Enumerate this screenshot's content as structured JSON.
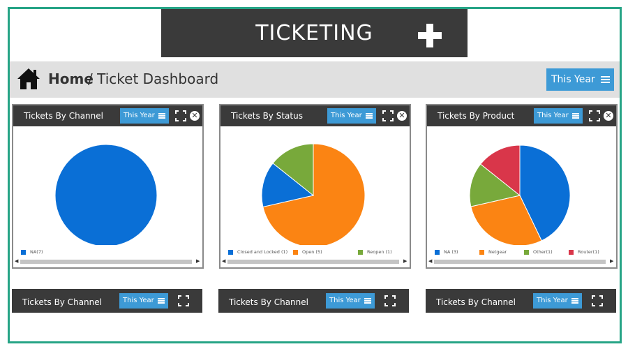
{
  "app": {
    "title": "TICKETING"
  },
  "breadcrumb": {
    "home": "Home",
    "separator": "/",
    "page": "Ticket Dashboard"
  },
  "filter": {
    "label": "This Year"
  },
  "colors": {
    "accent": "#3d9ad6",
    "frame": "#26a486",
    "header": "#3a3a3a",
    "blue": "#0a6fd6",
    "orange": "#fb8413",
    "green": "#78a93b",
    "red": "#d9364a"
  },
  "widgets": [
    {
      "title": "Tickets By Channel",
      "filter": "This Year",
      "legend": [
        {
          "label": "NA(7)",
          "color": "#0a6fd6"
        }
      ],
      "chart_data": {
        "type": "pie",
        "slices": [
          {
            "label": "NA",
            "value": 7,
            "color": "#0a6fd6"
          }
        ]
      }
    },
    {
      "title": "Tickets By Status",
      "filter": "This Year",
      "legend": [
        {
          "label": "Closed and Locked (1)",
          "color": "#0a6fd6"
        },
        {
          "label": "Open (5)",
          "color": "#fb8413"
        },
        {
          "label": "Reopen (1)",
          "color": "#78a93b"
        }
      ],
      "chart_data": {
        "type": "pie",
        "slices": [
          {
            "label": "Open",
            "value": 5,
            "color": "#fb8413"
          },
          {
            "label": "Closed and Locked",
            "value": 1,
            "color": "#0a6fd6"
          },
          {
            "label": "Reopen",
            "value": 1,
            "color": "#78a93b"
          }
        ]
      }
    },
    {
      "title": "Tickets By Product",
      "filter": "This Year",
      "legend": [
        {
          "label": "NA (3)",
          "color": "#0a6fd6"
        },
        {
          "label": "Netgear",
          "color": "#fb8413"
        },
        {
          "label": "Other(1)",
          "color": "#78a93b"
        },
        {
          "label": "Router(1)",
          "color": "#d9364a"
        }
      ],
      "chart_data": {
        "type": "pie",
        "slices": [
          {
            "label": "NA",
            "value": 3,
            "color": "#0a6fd6"
          },
          {
            "label": "Netgear",
            "value": 2,
            "color": "#fb8413"
          },
          {
            "label": "Other",
            "value": 1,
            "color": "#78a93b"
          },
          {
            "label": "Router",
            "value": 1,
            "color": "#d9364a"
          }
        ]
      }
    }
  ],
  "bottom_widgets": [
    {
      "title": "Tickets By Channel",
      "filter": "This Year"
    },
    {
      "title": "Tickets By Channel",
      "filter": "This Year"
    },
    {
      "title": "Tickets By Channel",
      "filter": "This Year"
    }
  ]
}
